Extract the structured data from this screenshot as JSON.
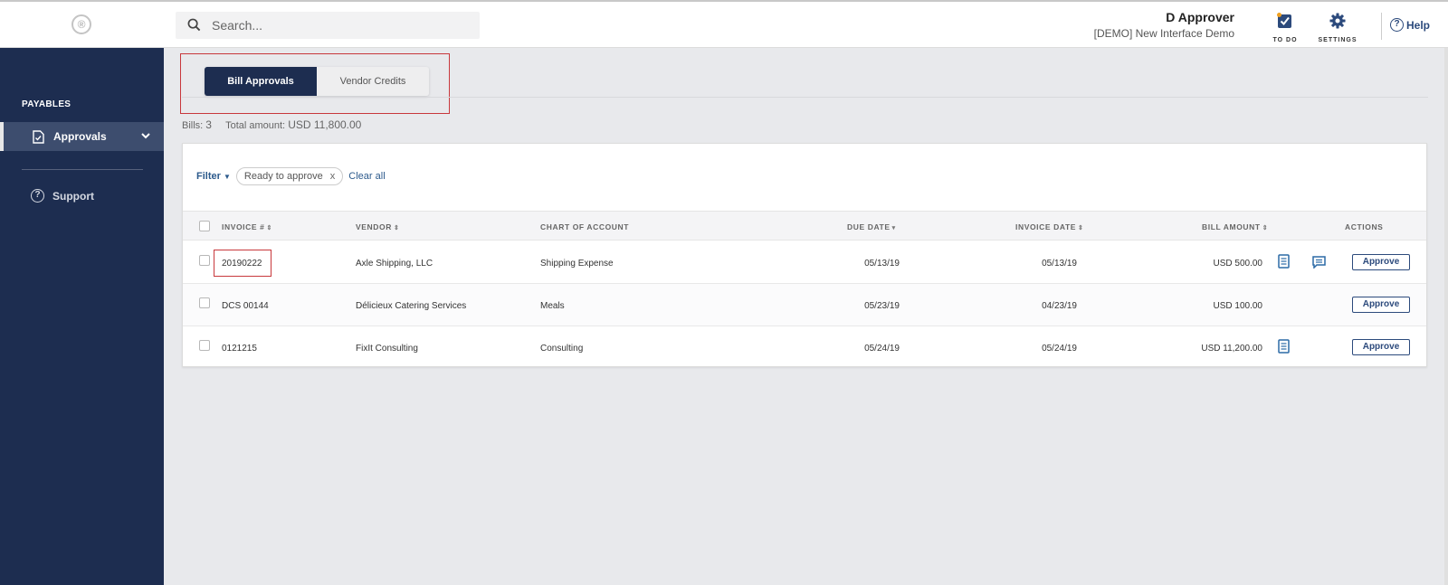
{
  "app": {
    "logo_glyph": "®"
  },
  "search": {
    "placeholder": "Search...",
    "value": ""
  },
  "user": {
    "name": "D Approver",
    "company": "[DEMO] New Interface Demo"
  },
  "toolbar": {
    "todo_label": "TO DO",
    "settings_label": "SETTINGS",
    "help_label": "Help"
  },
  "sidebar": {
    "section": "PAYABLES",
    "items": [
      {
        "label": "Approvals",
        "icon": "document-check-icon",
        "active": true
      },
      {
        "label": "Support",
        "icon": "question-circle-icon",
        "active": false
      }
    ]
  },
  "tabs": [
    {
      "label": "Bill Approvals",
      "active": true
    },
    {
      "label": "Vendor Credits",
      "active": false
    }
  ],
  "summary": {
    "bills_label": "Bills:",
    "bills_count": "3",
    "total_label": "Total amount:",
    "total_value": "USD 11,800.00"
  },
  "filter": {
    "label": "Filter",
    "chip": "Ready to approve",
    "chip_remove": "x",
    "clear_label": "Clear all"
  },
  "table": {
    "columns": {
      "invoice": "INVOICE #",
      "vendor": "VENDOR",
      "account": "CHART OF ACCOUNT",
      "due_date": "DUE DATE",
      "invoice_date": "INVOICE DATE",
      "amount": "BILL AMOUNT",
      "actions": "ACTIONS"
    },
    "rows": [
      {
        "invoice": "20190222",
        "vendor": "Axle Shipping, LLC",
        "account": "Shipping Expense",
        "due_date": "05/13/19",
        "invoice_date": "05/13/19",
        "amount": "USD 500.00",
        "has_document": true,
        "has_comment": true,
        "action": "Approve"
      },
      {
        "invoice": "DCS 00144",
        "vendor": "Délicieux Catering Services",
        "account": "Meals",
        "due_date": "05/23/19",
        "invoice_date": "04/23/19",
        "amount": "USD 100.00",
        "has_document": false,
        "has_comment": false,
        "action": "Approve"
      },
      {
        "invoice": "0121215",
        "vendor": "FixIt Consulting",
        "account": "Consulting",
        "due_date": "05/24/19",
        "invoice_date": "05/24/19",
        "amount": "USD 11,200.00",
        "has_document": true,
        "has_comment": false,
        "action": "Approve"
      }
    ]
  },
  "colors": {
    "sidebar_bg": "#1d2d50",
    "accent_blue": "#2c4a7c",
    "highlight_red": "#c8383c",
    "todo_badge": "#f0a020"
  }
}
